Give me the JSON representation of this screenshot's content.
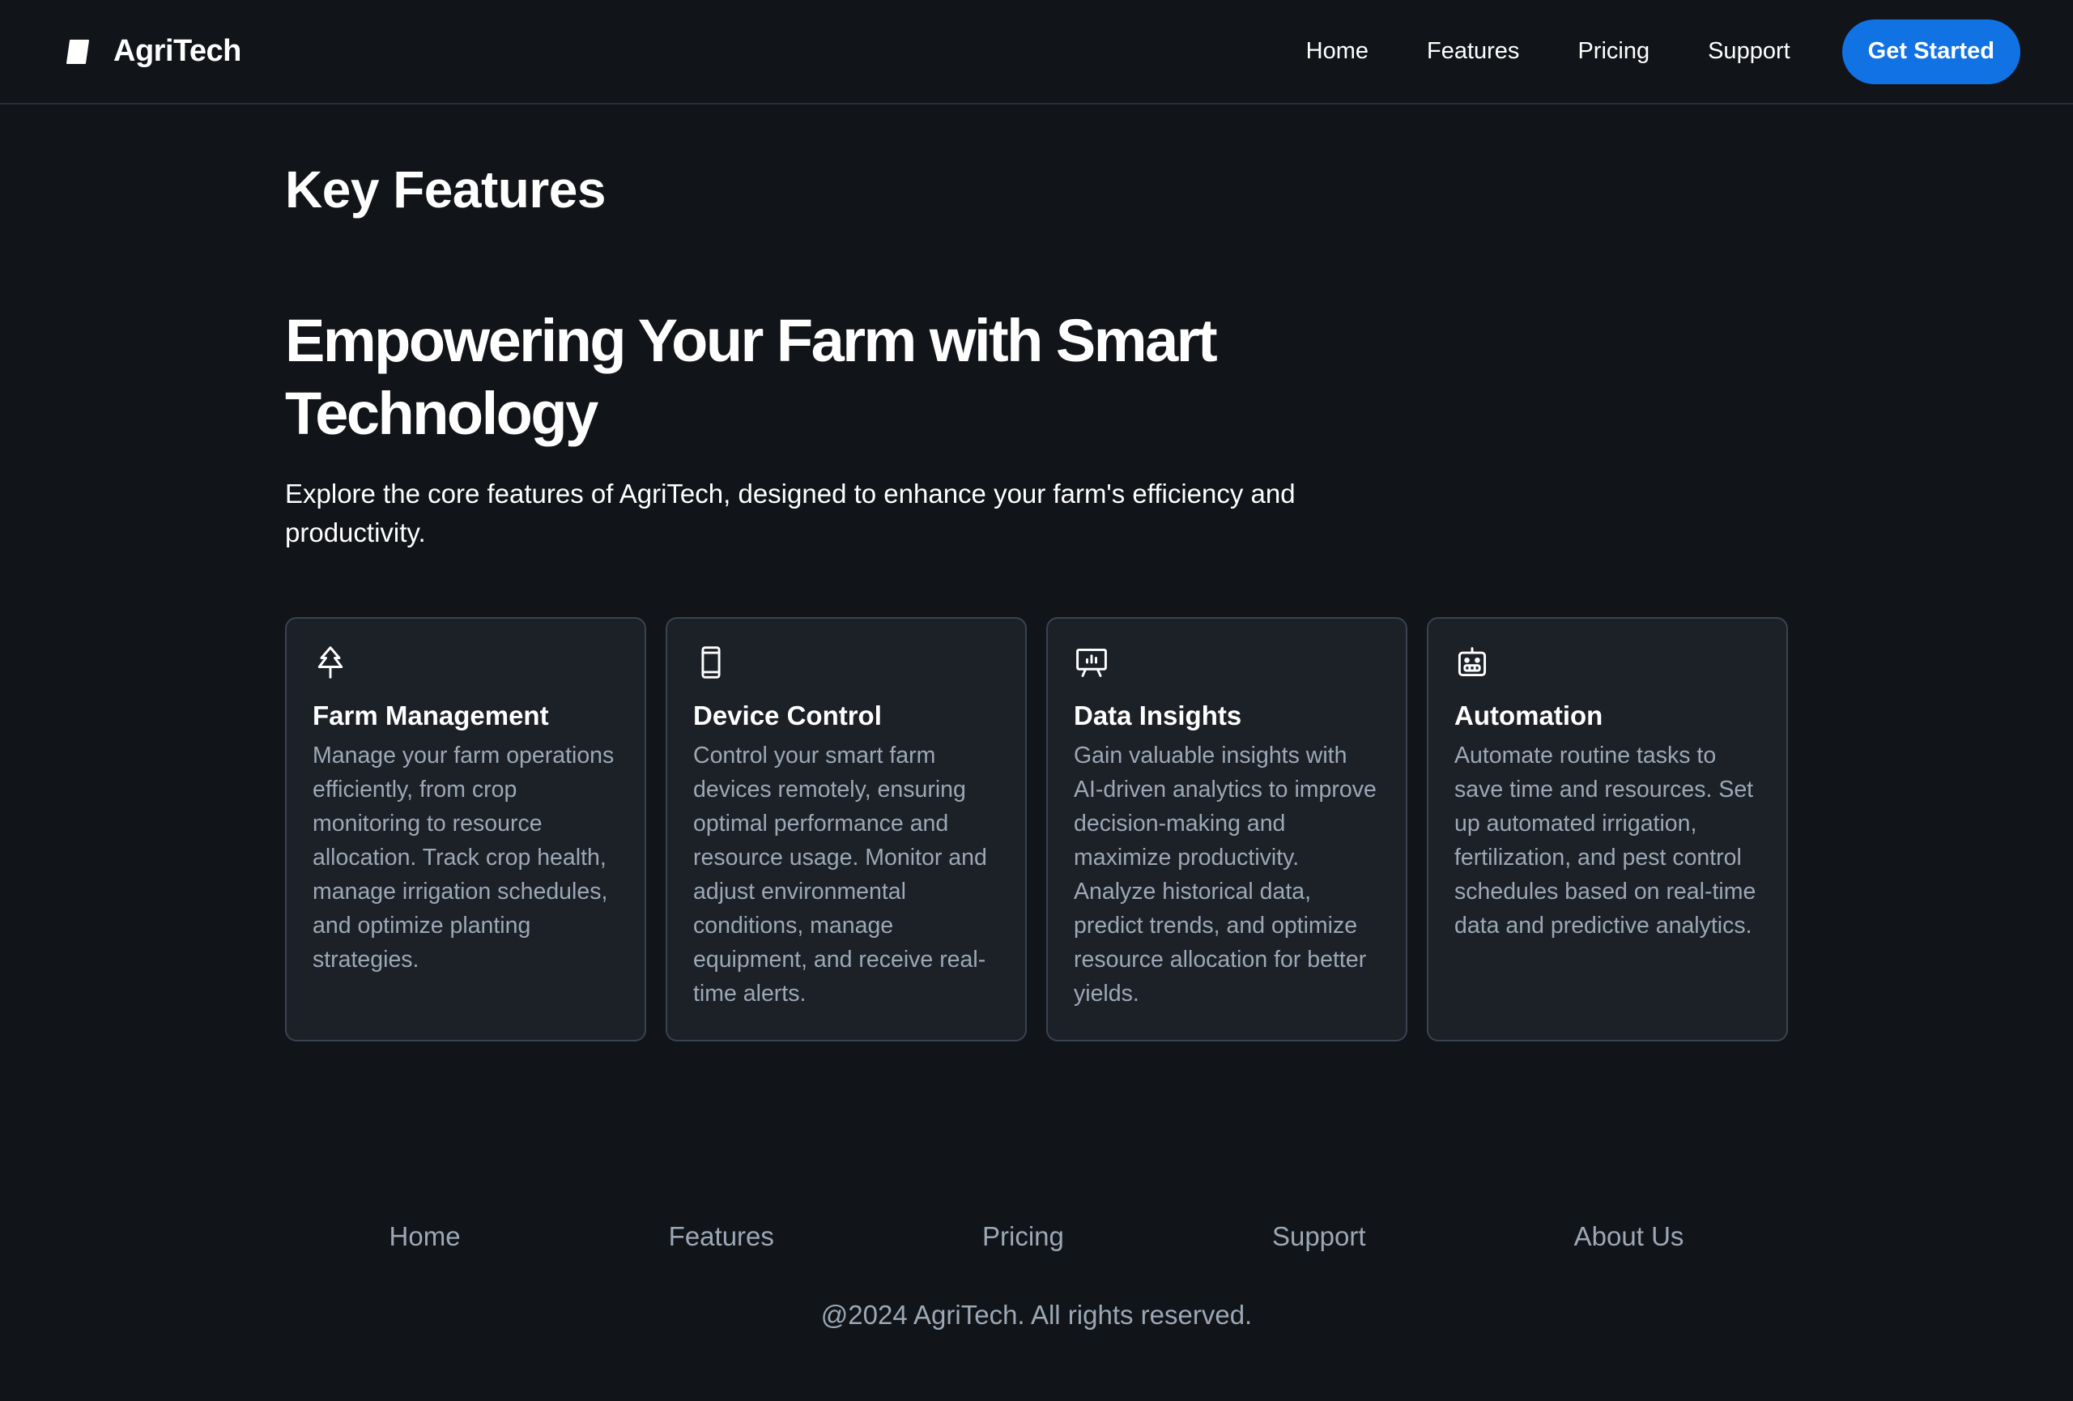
{
  "brand": {
    "name": "AgriTech",
    "logo_icon": "leaf-shape-icon"
  },
  "nav": {
    "links": [
      "Home",
      "Features",
      "Pricing",
      "Support"
    ],
    "cta_label": "Get Started"
  },
  "colors": {
    "background": "#111418",
    "card_background": "#1c2027",
    "card_border": "#3b4250",
    "accent": "#1172e4",
    "muted_text": "#9ca8b6"
  },
  "main": {
    "page_title": "Key Features",
    "hero_title": "Empowering Your Farm with Smart Technology",
    "hero_description": "Explore the core features of AgriTech, designed to enhance your farm's efficiency and productivity."
  },
  "features": [
    {
      "icon": "tree-icon",
      "title": "Farm Management",
      "text": "Manage your farm operations efficiently, from crop monitoring to resource allocation. Track crop health, manage irrigation schedules, and optimize planting strategies."
    },
    {
      "icon": "device-mobile-icon",
      "title": "Device Control",
      "text": "Control your smart farm devices remotely, ensuring optimal performance and resource usage. Monitor and adjust environmental conditions, manage equipment, and receive real-time alerts."
    },
    {
      "icon": "presentation-chart-icon",
      "title": "Data Insights",
      "text": "Gain valuable insights with AI-driven analytics to improve decision-making and maximize productivity. Analyze historical data, predict trends, and optimize resource allocation for better yields."
    },
    {
      "icon": "robot-icon",
      "title": "Automation",
      "text": "Automate routine tasks to save time and resources. Set up automated irrigation, fertilization, and pest control schedules based on real-time data and predictive analytics."
    }
  ],
  "footer": {
    "links": [
      "Home",
      "Features",
      "Pricing",
      "Support",
      "About Us"
    ],
    "copyright": "@2024 AgriTech. All rights reserved."
  }
}
